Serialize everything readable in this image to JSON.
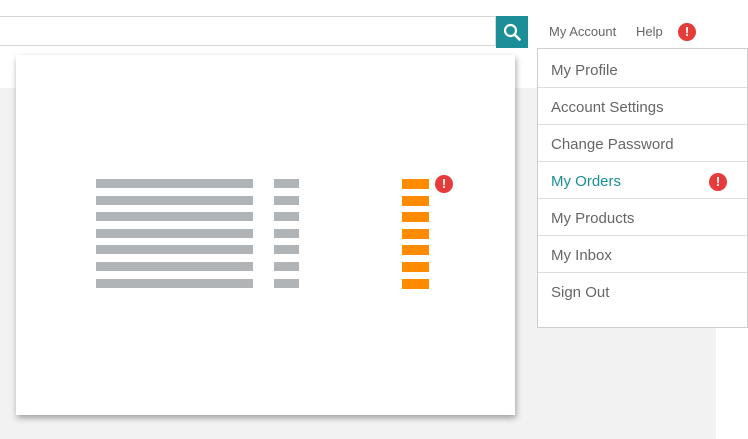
{
  "header": {
    "search": {
      "value": "",
      "placeholder": ""
    },
    "search_icon": "search-icon",
    "nav": [
      {
        "label": "My Account"
      },
      {
        "label": "Help"
      }
    ],
    "alert_symbol": "!"
  },
  "illustration": {
    "left_column_lines": 7,
    "middle_column_lines": 7,
    "right_column_lines": 7,
    "alert_symbol": "!",
    "colors": {
      "gray": "#b0b4b6",
      "orange": "#ff8c00",
      "alert": "#e53b3b"
    }
  },
  "dropdown": {
    "items": [
      {
        "label": "My Profile"
      },
      {
        "label": "Account Settings"
      },
      {
        "label": "Change Password"
      },
      {
        "label": "My Orders",
        "active": true,
        "alert": "!"
      },
      {
        "label": "My Products"
      },
      {
        "label": "My Inbox"
      },
      {
        "label": "Sign Out"
      }
    ]
  },
  "colors": {
    "accent": "#1b8e98",
    "alert": "#e53b3b",
    "background": "#f2f2f2"
  }
}
